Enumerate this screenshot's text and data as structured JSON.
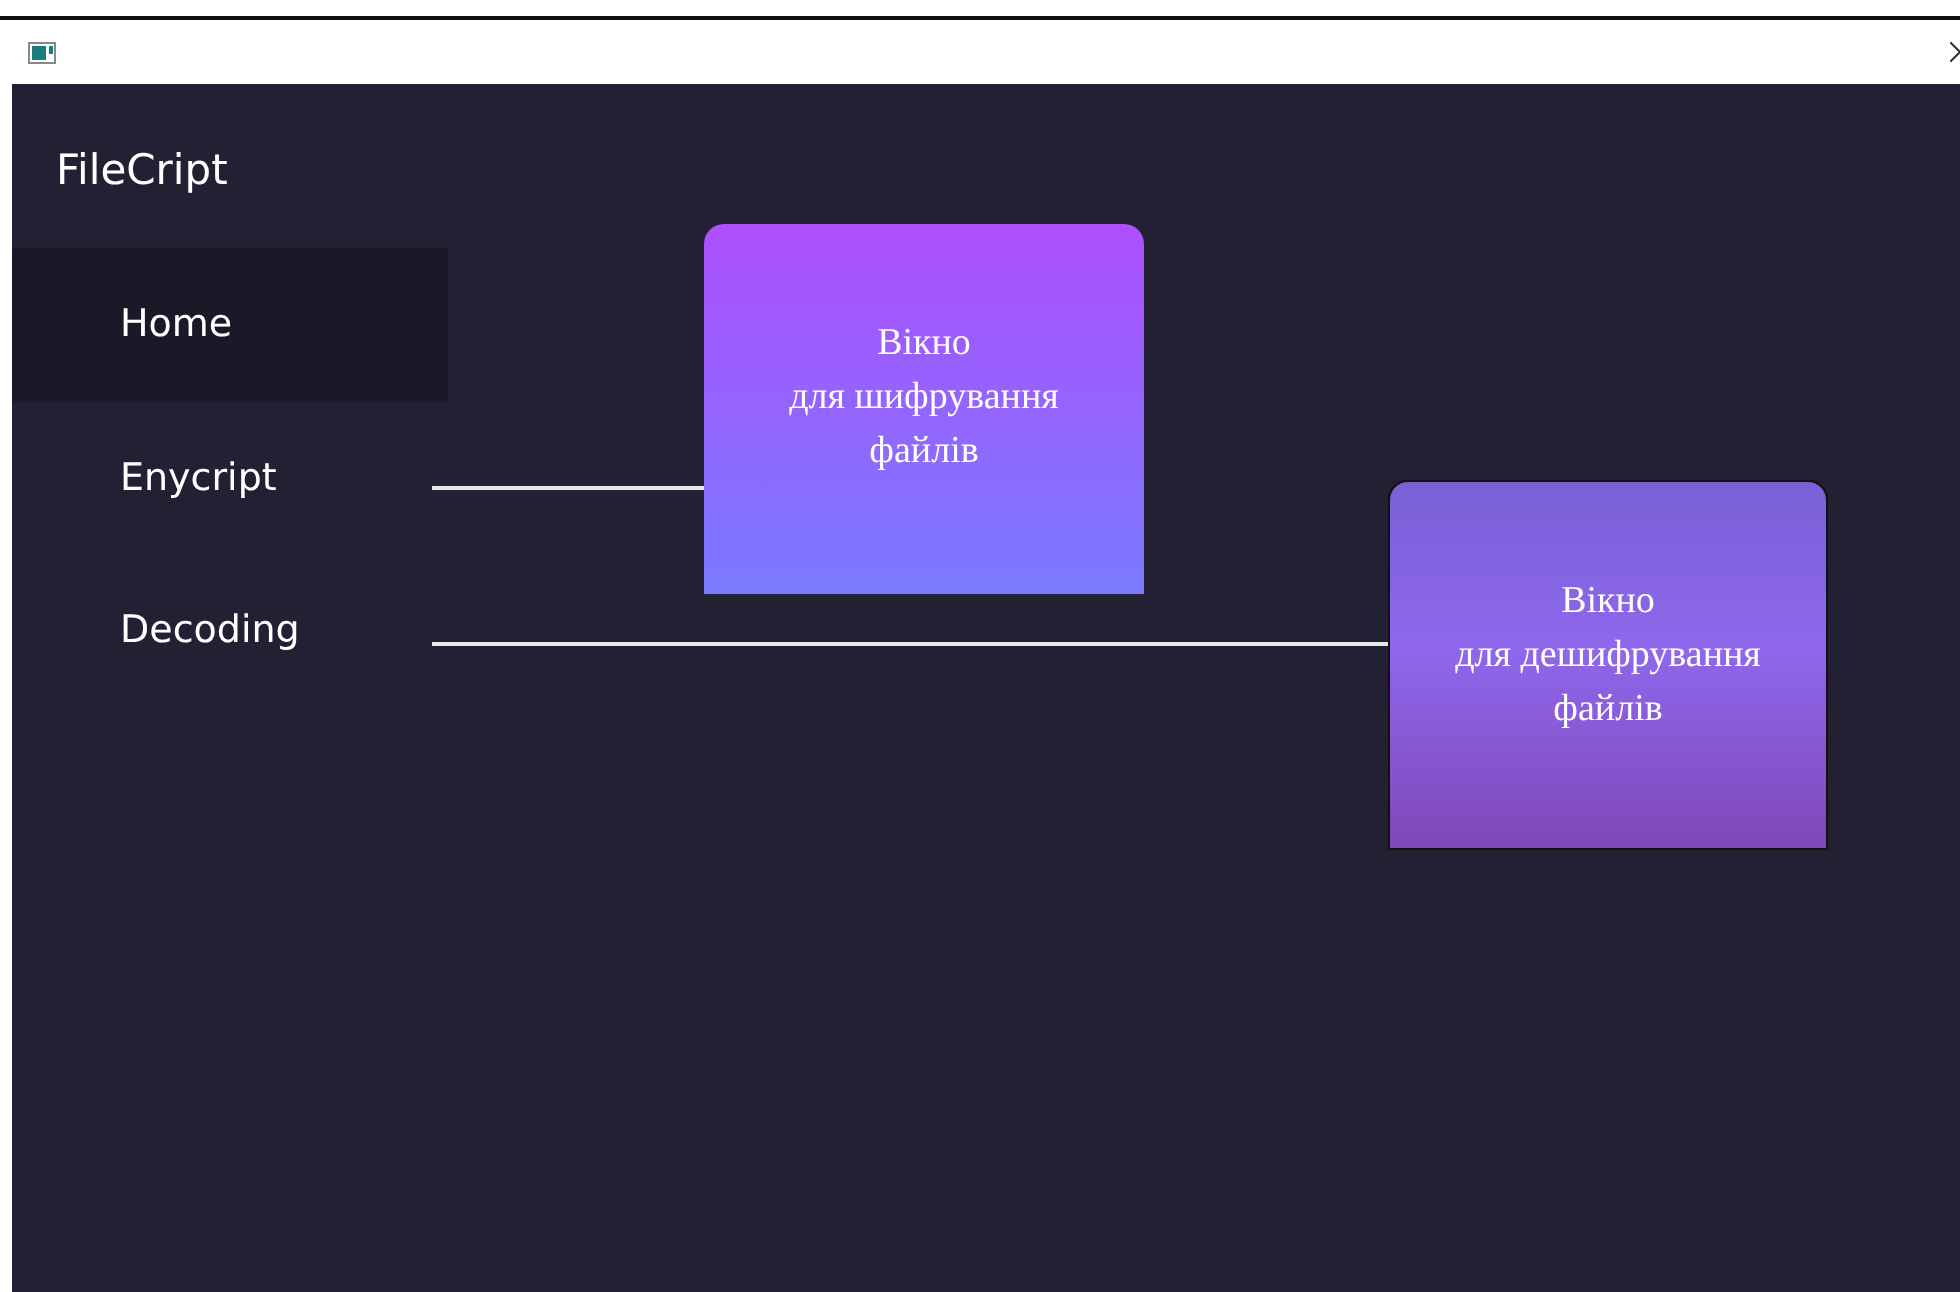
{
  "app_title": "FileCript",
  "nav": [
    {
      "label": "Home",
      "selected": true
    },
    {
      "label": "Enycript",
      "selected": false
    },
    {
      "label": "Decoding",
      "selected": false
    }
  ],
  "cards": [
    {
      "kind": "encrypt",
      "text": "Вікно\nдля шифрування\nфайлів"
    },
    {
      "kind": "decrypt",
      "text": "Вікно\nдля дешифрування\nфайлів"
    }
  ]
}
